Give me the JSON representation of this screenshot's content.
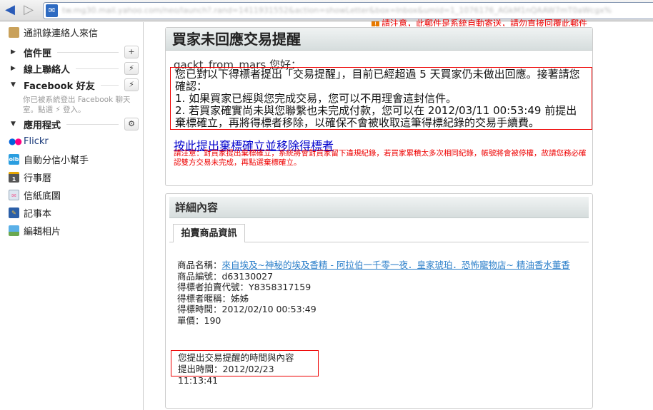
{
  "browser": {
    "back_icon": "back-arrow-icon",
    "forward_icon": "forward-arrow-icon",
    "url": "tw.mg30.mail.yahoo.com/neo/launch?.rand=1411931552&action=showLetter&box=Inbox&umid=1_1076176_AGkM1nQAAW7mT0aWcgx%"
  },
  "sidebar": {
    "contacts_mail": "通訊錄連絡人來信",
    "sections": [
      {
        "label": "信件匣",
        "expanded": false,
        "button": "+"
      },
      {
        "label": "線上聯絡人",
        "expanded": false,
        "button": "⚡"
      },
      {
        "label": "Facebook 好友",
        "expanded": true,
        "button": "⚡"
      },
      {
        "label": "應用程式",
        "expanded": true,
        "button": "⚙"
      }
    ],
    "facebook_note": "你已被系統登出 Facebook 聊天室。點選 ⚡ 登入。",
    "apps": [
      "Flickr",
      "自動分信小幫手",
      "行事曆",
      "信紙底圖",
      "記事本",
      "編輯相片"
    ]
  },
  "notice": "請注意，此郵件是系統自動寄送，請勿直接回覆此郵件",
  "mail": {
    "title": "買家未回應交易提醒",
    "greeting": "gackt_from_mars 您好：",
    "message_lines": [
      "您已對以下得標者提出「交易提醒」，目前已經超過 5 天買家仍未做出回應。接著請您確認：",
      "1. 如果買家已經與您完成交易，您可以不用理會這封信件。",
      "2. 若買家確實尚未與您聯繫也未完成付款，您可以在 2012/03/11 00:53:49 前提出棄標確立，再將得標者移除，以確保不會被收取這筆得標紀錄的交易手續費。"
    ],
    "revoke_link": "按此提出棄標確立並移除得標者",
    "revoke_warning": "請注意：對買家提出棄標確立，系統將會對買家留下違規紀錄，若買家累積太多次相同紀錄，帳號將會被停權，故請您務必確認雙方交易未完成，再點選棄標確立。"
  },
  "details": {
    "title": "詳細內容",
    "tab": "拍賣商品資訊",
    "item_name_label": "商品名稱：",
    "item_name": "來自埃及~神秘的埃及香精 - 阿拉伯一千零一夜．皇家琥珀．恐怖寵物店~ 精油香水董香",
    "item_id": "商品編號：d63130027",
    "winner_id": "得標者拍賣代號：Y8358317159",
    "winner_nick": "得標者暱稱：姊姊",
    "win_time": "得標時間：2012/02/10 00:53:49",
    "price": "單價：190",
    "reminder_title": "您提出交易提醒的時間與內容",
    "reminder_time": "提出時間：2012/02/23 11:13:41"
  }
}
